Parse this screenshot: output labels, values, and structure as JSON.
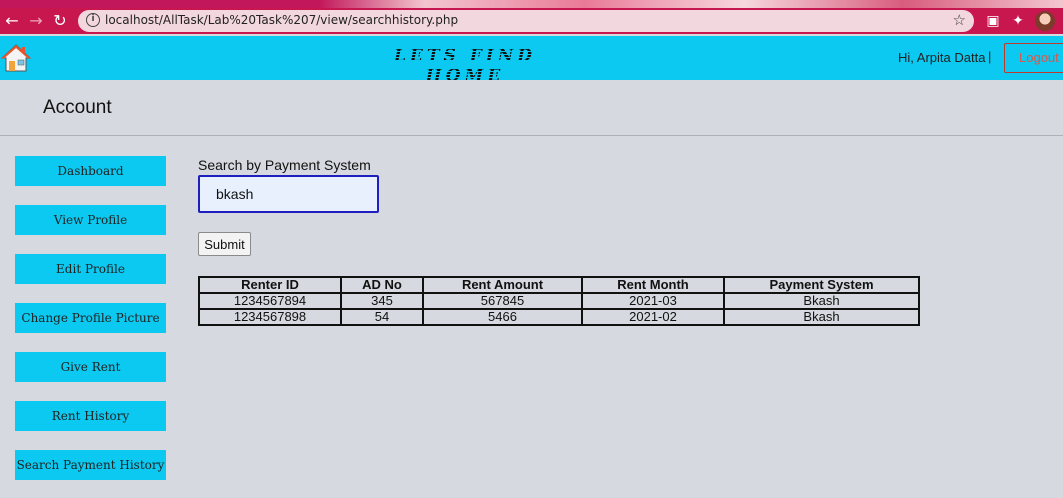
{
  "browser": {
    "url": "localhost/AllTask/Lab%20Task%207/view/searchhistory.php",
    "back_icon": "arrow-left-icon",
    "forward_icon": "arrow-right-icon",
    "reload_icon": "reload-icon",
    "info_icon": "info-icon",
    "star_icon": "star-icon"
  },
  "header": {
    "brand": "LETS FIND HOME",
    "greeting": "Hi, Arpita Datta",
    "divider": "|",
    "logout_label": "Logout"
  },
  "account": {
    "title": "Account"
  },
  "sidebar": {
    "items": [
      {
        "label": "Dashboard"
      },
      {
        "label": "View Profile"
      },
      {
        "label": "Edit Profile"
      },
      {
        "label": "Change Profile Picture"
      },
      {
        "label": "Give Rent"
      },
      {
        "label": "Rent History"
      },
      {
        "label": "Search Payment History"
      }
    ]
  },
  "search": {
    "label": "Search by Payment System",
    "value": "bkash",
    "submit_label": "Submit"
  },
  "table": {
    "headers": [
      "Renter ID",
      "AD No",
      "Rent Amount",
      "Rent Month",
      "Payment System"
    ],
    "rows": [
      [
        "1234567894",
        "345",
        "567845",
        "2021-03",
        "Bkash"
      ],
      [
        "1234567898",
        "54",
        "5466",
        "2021-02",
        "Bkash"
      ]
    ]
  },
  "colors": {
    "header_bg": "#0bc9f0",
    "sidebar_button": "#0bc9f0",
    "browser_bar": "#c8164f",
    "page_bg": "#d6d9df",
    "logout_text": "#e25547",
    "input_border": "#1f1fbf"
  }
}
